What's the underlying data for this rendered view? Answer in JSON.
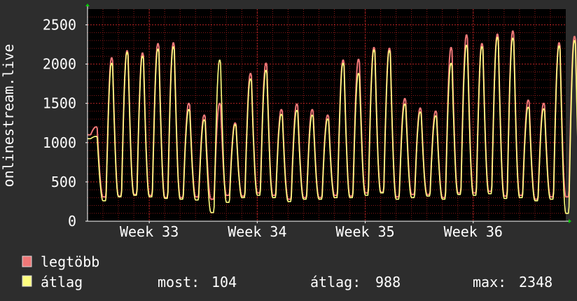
{
  "chart_data": {
    "type": "line",
    "ylabel": "onlinestream.live",
    "ylim": [
      0,
      2700
    ],
    "yticks": [
      0,
      500,
      1000,
      1500,
      2000,
      2500
    ],
    "ytick_labels": [
      "0",
      "500",
      "1000",
      "1500",
      "2000",
      "2500"
    ],
    "x_range_days": [
      0,
      31
    ],
    "xtick_positions_days": [
      4,
      11,
      18,
      25
    ],
    "xtick_labels": [
      "Week 33",
      "Week 34",
      "Week 35",
      "Week 36"
    ],
    "grid": true,
    "legend_position": "bottom-left",
    "background_color": "#000000",
    "grid_color": "#8b1a1a",
    "axis_color": "#ffffff",
    "series": [
      {
        "name": "legtöbb",
        "color": "#f07878",
        "daily_peaks": [
          1200,
          2080,
          2170,
          2140,
          2260,
          2270,
          1500,
          1350,
          1500,
          1250,
          1880,
          2010,
          1420,
          1490,
          1420,
          1350,
          2050,
          2060,
          2210,
          2200,
          1560,
          1440,
          1400,
          2210,
          2370,
          2260,
          2380,
          2420,
          1540,
          1500,
          2270,
          2350
        ],
        "daily_troughs": [
          1100,
          310,
          320,
          340,
          330,
          300,
          300,
          310,
          280,
          330,
          320,
          360,
          330,
          280,
          300,
          300,
          330,
          320,
          360,
          370,
          310,
          340,
          340,
          300,
          360,
          360,
          380,
          320,
          330,
          280,
          310,
          310
        ]
      },
      {
        "name": "átlag",
        "color": "#ffff80",
        "daily_peaks": [
          1080,
          2010,
          2150,
          2100,
          2190,
          2220,
          1420,
          1290,
          2050,
          1230,
          1810,
          1920,
          1360,
          1410,
          1350,
          1300,
          2010,
          1880,
          2180,
          2170,
          1490,
          1390,
          1340,
          2010,
          2240,
          2220,
          2340,
          2330,
          1450,
          1430,
          2230,
          2300
        ],
        "daily_troughs": [
          1050,
          260,
          310,
          330,
          310,
          290,
          280,
          270,
          110,
          240,
          300,
          330,
          300,
          250,
          280,
          280,
          300,
          300,
          330,
          360,
          280,
          300,
          320,
          280,
          340,
          330,
          350,
          290,
          300,
          260,
          280,
          100
        ]
      }
    ],
    "stats": {
      "most_label": "most:",
      "most_value": "104",
      "atlag_label": "átlag:",
      "atlag_value": "988",
      "max_label": "max:",
      "max_value": "2348"
    }
  }
}
